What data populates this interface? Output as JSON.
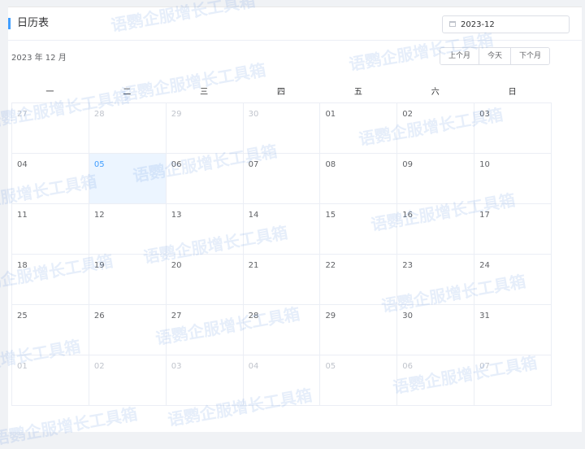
{
  "header": {
    "title": "日历表"
  },
  "month_picker": {
    "value": "2023-12"
  },
  "calendar": {
    "title": "2023 年 12 月",
    "buttons": {
      "prev": "上个月",
      "today": "今天",
      "next": "下个月"
    },
    "weekdays": [
      "一",
      "二",
      "三",
      "四",
      "五",
      "六",
      "日"
    ],
    "rows": [
      [
        {
          "d": "27",
          "t": "other"
        },
        {
          "d": "28",
          "t": "other"
        },
        {
          "d": "29",
          "t": "other"
        },
        {
          "d": "30",
          "t": "other"
        },
        {
          "d": "01",
          "t": "current"
        },
        {
          "d": "02",
          "t": "current"
        },
        {
          "d": "03",
          "t": "current"
        }
      ],
      [
        {
          "d": "04",
          "t": "current"
        },
        {
          "d": "05",
          "t": "selected"
        },
        {
          "d": "06",
          "t": "current"
        },
        {
          "d": "07",
          "t": "current"
        },
        {
          "d": "08",
          "t": "current"
        },
        {
          "d": "09",
          "t": "current"
        },
        {
          "d": "10",
          "t": "current"
        }
      ],
      [
        {
          "d": "11",
          "t": "current"
        },
        {
          "d": "12",
          "t": "current"
        },
        {
          "d": "13",
          "t": "current"
        },
        {
          "d": "14",
          "t": "current"
        },
        {
          "d": "15",
          "t": "current"
        },
        {
          "d": "16",
          "t": "current"
        },
        {
          "d": "17",
          "t": "current"
        }
      ],
      [
        {
          "d": "18",
          "t": "current"
        },
        {
          "d": "19",
          "t": "current"
        },
        {
          "d": "20",
          "t": "current"
        },
        {
          "d": "21",
          "t": "current"
        },
        {
          "d": "22",
          "t": "current"
        },
        {
          "d": "23",
          "t": "current"
        },
        {
          "d": "24",
          "t": "current"
        }
      ],
      [
        {
          "d": "25",
          "t": "current"
        },
        {
          "d": "26",
          "t": "current"
        },
        {
          "d": "27",
          "t": "current"
        },
        {
          "d": "28",
          "t": "current"
        },
        {
          "d": "29",
          "t": "current"
        },
        {
          "d": "30",
          "t": "current"
        },
        {
          "d": "31",
          "t": "current"
        }
      ],
      [
        {
          "d": "01",
          "t": "other"
        },
        {
          "d": "02",
          "t": "other"
        },
        {
          "d": "03",
          "t": "other"
        },
        {
          "d": "04",
          "t": "other"
        },
        {
          "d": "05",
          "t": "other"
        },
        {
          "d": "06",
          "t": "other"
        },
        {
          "d": "07",
          "t": "other"
        }
      ]
    ]
  },
  "watermark": {
    "text": "语鹦企服增长工具箱"
  },
  "colors": {
    "accent": "#409eff",
    "selected_bg": "#ecf5ff",
    "muted": "#c0c4cc"
  }
}
